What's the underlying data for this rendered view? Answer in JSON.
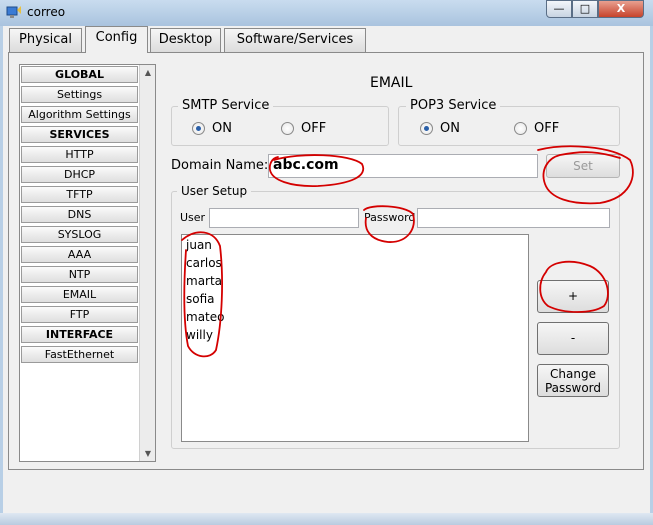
{
  "window": {
    "title": "correo",
    "minimize_label": "—",
    "maximize_label": "□",
    "close_label": "X"
  },
  "tabs": [
    {
      "label": "Physical"
    },
    {
      "label": "Config"
    },
    {
      "label": "Desktop"
    },
    {
      "label": "Software/Services"
    }
  ],
  "sidebar": {
    "items": [
      {
        "label": "GLOBAL"
      },
      {
        "label": "Settings"
      },
      {
        "label": "Algorithm Settings"
      },
      {
        "label": "SERVICES"
      },
      {
        "label": "HTTP"
      },
      {
        "label": "DHCP"
      },
      {
        "label": "TFTP"
      },
      {
        "label": "DNS"
      },
      {
        "label": "SYSLOG"
      },
      {
        "label": "AAA"
      },
      {
        "label": "NTP"
      },
      {
        "label": "EMAIL"
      },
      {
        "label": "FTP"
      },
      {
        "label": "INTERFACE"
      },
      {
        "label": "FastEthernet"
      }
    ],
    "scroll_up": "▲",
    "scroll_down": "▼"
  },
  "email": {
    "heading": "EMAIL",
    "smtp": {
      "title": "SMTP Service",
      "on_label": "ON",
      "off_label": "OFF",
      "selected": "ON"
    },
    "pop3": {
      "title": "POP3 Service",
      "on_label": "ON",
      "off_label": "OFF",
      "selected": "ON"
    },
    "domain": {
      "label": "Domain Name:",
      "value": "abc.com"
    },
    "set_button": "Set",
    "user_setup": {
      "title": "User Setup",
      "user_label": "User",
      "user_value": "",
      "password_label": "Password",
      "password_value": "",
      "users": [
        "juan",
        "carlos",
        "marta",
        "sofia",
        "mateo",
        "willy"
      ],
      "add_button": "+",
      "remove_button": "-",
      "change_password_line1": "Change",
      "change_password_line2": "Password"
    }
  },
  "colors": {
    "annotation": "#d40000",
    "radio_dot": "#2a5fa8"
  }
}
